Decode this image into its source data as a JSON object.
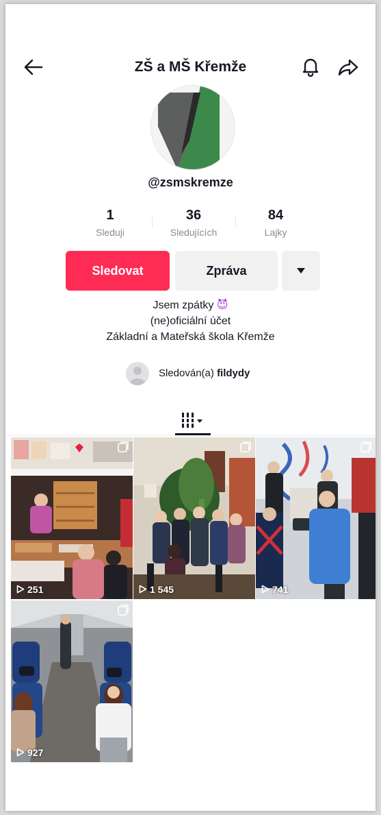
{
  "header": {
    "title": "ZŠ a MŠ Křemže"
  },
  "profile": {
    "handle": "@zsmskremze"
  },
  "stats": [
    {
      "value": "1",
      "label": "Sleduji"
    },
    {
      "value": "36",
      "label": "Sledujících"
    },
    {
      "value": "84",
      "label": "Lajky"
    }
  ],
  "actions": {
    "follow_label": "Sledovat",
    "message_label": "Zpráva"
  },
  "bio": {
    "line1": "Jsem zpátky",
    "line1_emoji": "😈",
    "line2": "(ne)oficiální účet",
    "line3": "Základní a Mateřská škola Křemže"
  },
  "followed_by": {
    "prefix": "Sledován(a)",
    "name": "fildydy"
  },
  "videos": [
    {
      "views": "251"
    },
    {
      "views": "1 545"
    },
    {
      "views": "741"
    },
    {
      "views": "927"
    }
  ],
  "colors": {
    "accent": "#fe2c55",
    "text": "#161823",
    "muted": "#8a8b91"
  },
  "icons": {
    "back": "arrow-left-icon",
    "bell": "bell-icon",
    "share": "share-icon",
    "grid": "grid-icon",
    "play": "play-icon",
    "multi": "multi-image-icon"
  }
}
